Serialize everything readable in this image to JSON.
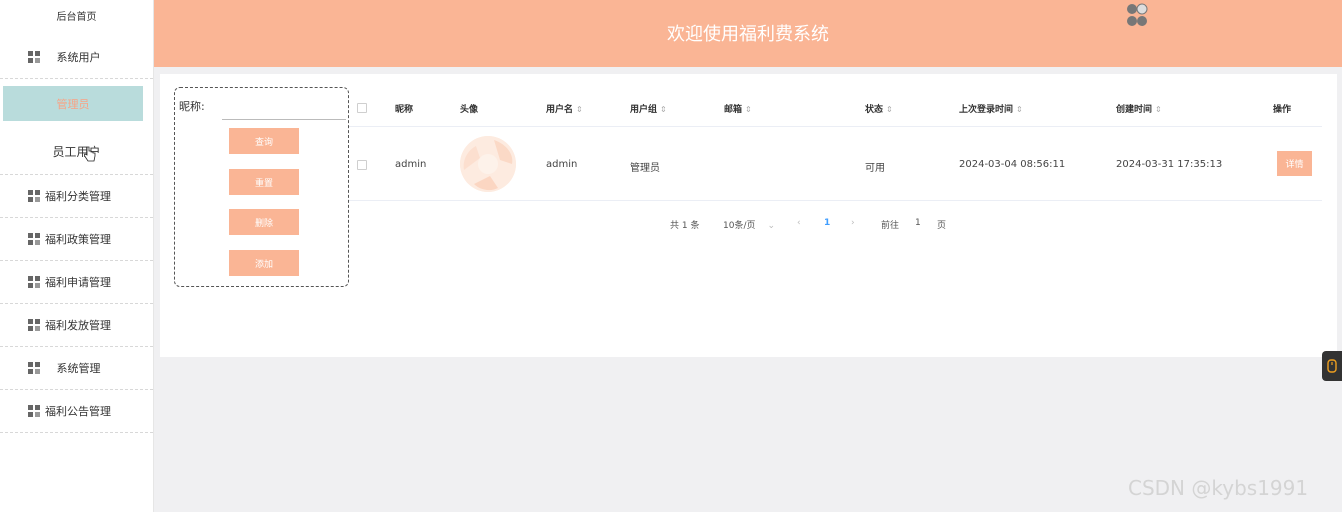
{
  "header": {
    "title": "欢迎使用福利费系统"
  },
  "sidebar": {
    "home": "后台首页",
    "system_users": "系统用户",
    "sub_admin": "管理员",
    "sub_staff": "员工用户",
    "items": [
      {
        "label": "福利分类管理"
      },
      {
        "label": "福利政策管理"
      },
      {
        "label": "福利申请管理"
      },
      {
        "label": "福利发放管理"
      },
      {
        "label": "系统管理"
      },
      {
        "label": "福利公告管理"
      }
    ]
  },
  "search": {
    "label": "昵称:",
    "value": "",
    "buttons": {
      "query": "查询",
      "reset": "重置",
      "delete": "删除",
      "add": "添加"
    }
  },
  "table": {
    "headers": {
      "nickname": "昵称",
      "avatar": "头像",
      "username": "用户名",
      "group": "用户组",
      "email": "邮箱",
      "status": "状态",
      "last_login": "上次登录时间",
      "created": "创建时间",
      "ops": "操作"
    },
    "rows": [
      {
        "nickname": "admin",
        "username": "admin",
        "group": "管理员",
        "email": "",
        "status": "可用",
        "last_login": "2024-03-04 08:56:11",
        "created": "2024-03-31 17:35:13",
        "detail": "详情"
      }
    ]
  },
  "pagination": {
    "total": "共 1 条",
    "page_size": "10条/页",
    "current": "1",
    "goto_label": "前往",
    "goto_value": "1",
    "page_suffix": "页"
  },
  "watermark": "CSDN @kybs1991",
  "colors": {
    "accent": "#fab595",
    "active_bg": "#b9dcdc",
    "link": "#409eff"
  }
}
